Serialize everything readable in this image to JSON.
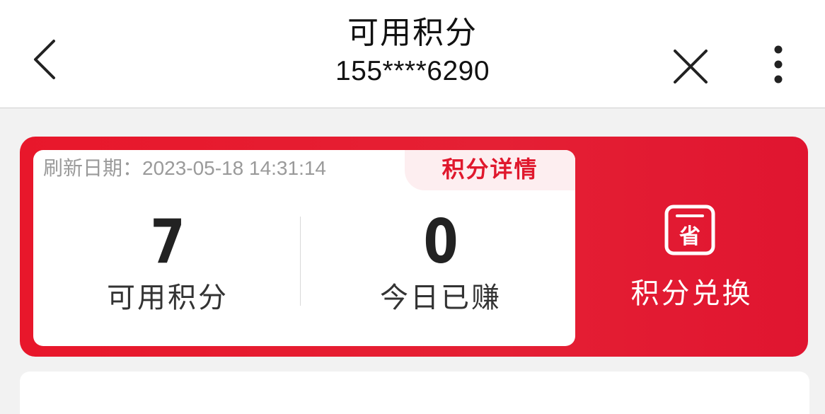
{
  "header": {
    "title": "可用积分",
    "subtitle": "155****6290",
    "back_icon": "chevron-left-icon",
    "close_icon": "close-icon",
    "more_icon": "more-vertical-icon"
  },
  "points_card": {
    "refresh_text": "刷新日期：2023-05-18 14:31:14",
    "details_label": "积分详情",
    "available": {
      "value": "7",
      "label": "可用积分"
    },
    "earned_today": {
      "value": "0",
      "label": "今日已赚"
    },
    "exchange": {
      "icon": "save-coupon-icon",
      "icon_text": "省",
      "label": "积分兑换"
    }
  },
  "colors": {
    "accent": "#e8172b",
    "details_tab_bg": "#fdeef0",
    "background": "#f2f2f2"
  }
}
